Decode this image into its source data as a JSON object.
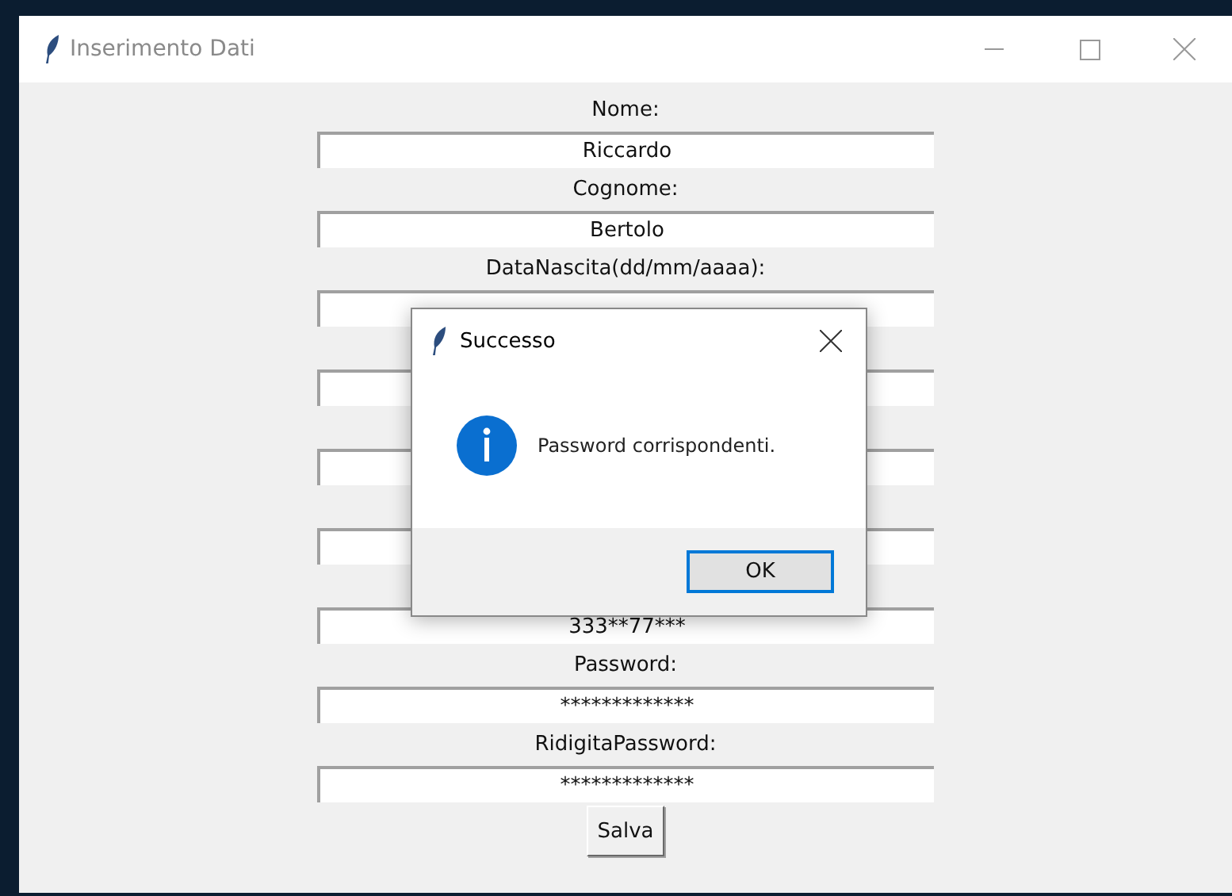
{
  "window": {
    "title": "Inserimento Dati"
  },
  "form": {
    "rows": [
      {
        "label": "Nome:",
        "value": "Riccardo"
      },
      {
        "label": "Cognome:",
        "value": "Bertolo"
      },
      {
        "label": "DataNascita(dd/mm/aaaa):"
      },
      {},
      {},
      {},
      {
        "value": "333**77***"
      },
      {
        "label": "Password:",
        "value": "*************"
      },
      {
        "label": "RidigitaPassword:",
        "value": "*************"
      }
    ],
    "button": "Salva"
  },
  "dialog": {
    "title": "Successo",
    "message": "Password corrispondenti.",
    "button": "OK"
  }
}
